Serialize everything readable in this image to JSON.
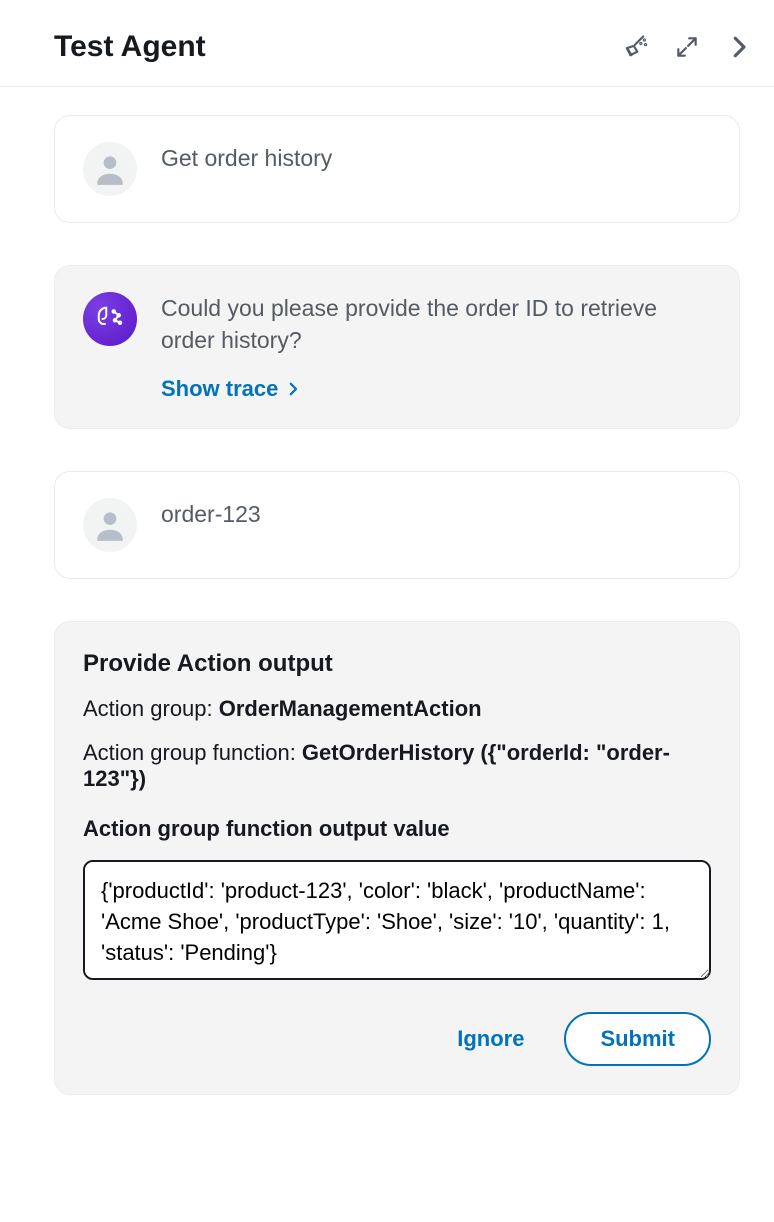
{
  "header": {
    "title": "Test Agent"
  },
  "messages": {
    "user1": "Get order history",
    "agent1": "Could you please provide the order ID to retrieve order history?",
    "show_trace": "Show trace",
    "user2": "order-123"
  },
  "action": {
    "title": "Provide Action output",
    "group_label": "Action group: ",
    "group_value": "OrderManagementAction",
    "fn_label": "Action group function: ",
    "fn_value": "GetOrderHistory ({\"orderId: \"order-123\"})",
    "output_label": "Action group function output value",
    "output_value": "{'productId': 'product-123', 'color': 'black', 'productName': 'Acme Shoe', 'productType': 'Shoe', 'size': '10', 'quantity': 1, 'status': 'Pending'}",
    "ignore": "Ignore",
    "submit": "Submit"
  }
}
